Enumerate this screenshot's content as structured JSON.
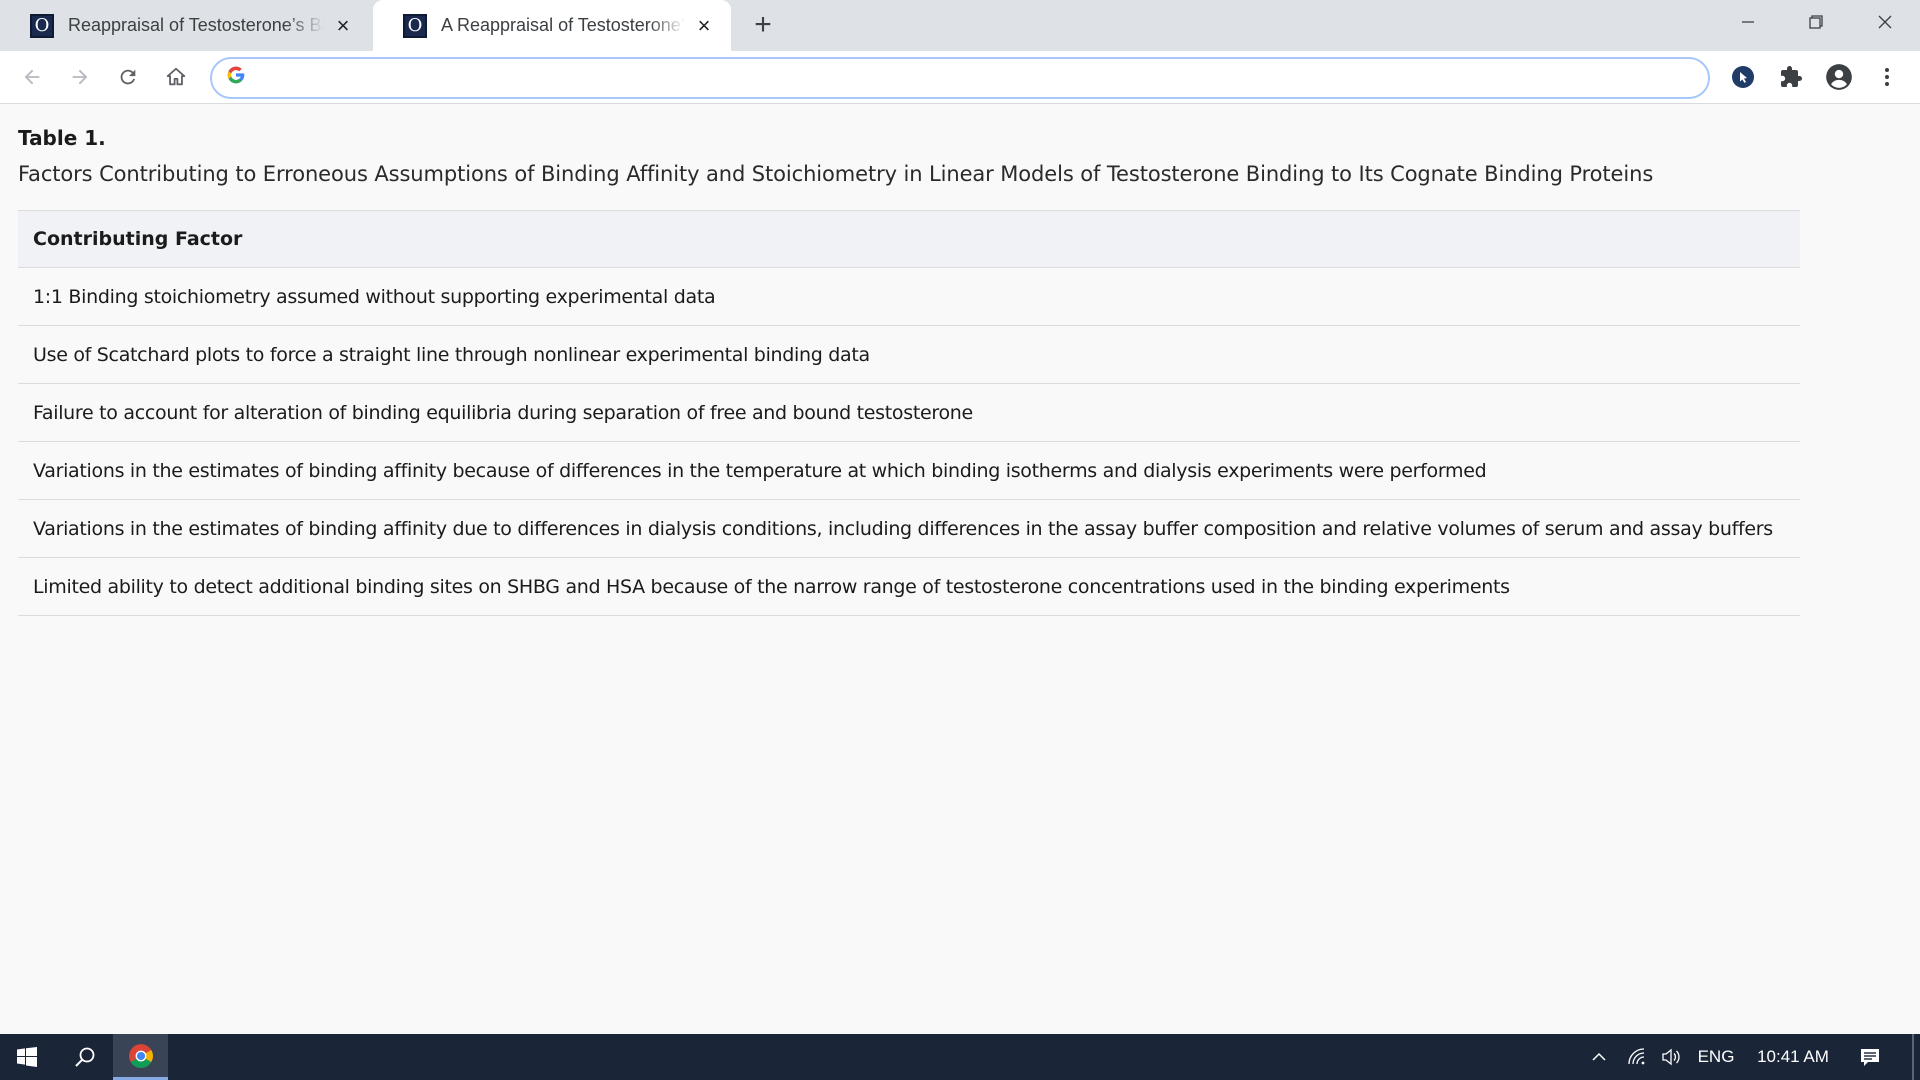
{
  "browser": {
    "tabs": [
      {
        "title": "Reappraisal of Testosterone’s Binding",
        "favicon": "O",
        "active": false
      },
      {
        "title": "A Reappraisal of Testosterone’s Binding",
        "favicon": "O",
        "active": true
      }
    ],
    "address_bar": {
      "value": "",
      "placeholder": ""
    }
  },
  "document": {
    "table_label": "Table 1.",
    "table_caption": "Factors Contributing to Erroneous Assumptions of Binding Affinity and Stoichiometry in Linear Models of Testosterone Binding to Its Cognate Binding Proteins",
    "table": {
      "header": "Contributing Factor",
      "rows": [
        "1:1 Binding stoichiometry assumed without supporting experimental data",
        "Use of Scatchard plots to force a straight line through nonlinear experimental binding data",
        "Failure to account for alteration of binding equilibria during separation of free and bound testosterone",
        "Variations in the estimates of binding affinity because of differences in the temperature at which binding isotherms and dialysis experiments were performed",
        "Variations in the estimates of binding affinity due to differences in dialysis conditions, including differences in the assay buffer composition and relative volumes of serum and assay buffers",
        "Limited ability to detect additional binding sites on SHBG and HSA because of the narrow range of testosterone concentrations used in the binding experiments"
      ]
    }
  },
  "taskbar": {
    "language": "ENG",
    "time": "10:41 AM"
  },
  "colors": {
    "tabstrip_bg": "#dee1e6",
    "table_header_bg": "#f0f2f5",
    "taskbar_bg": "#1a2538",
    "omnibox_focus": "#a8c7fa"
  }
}
